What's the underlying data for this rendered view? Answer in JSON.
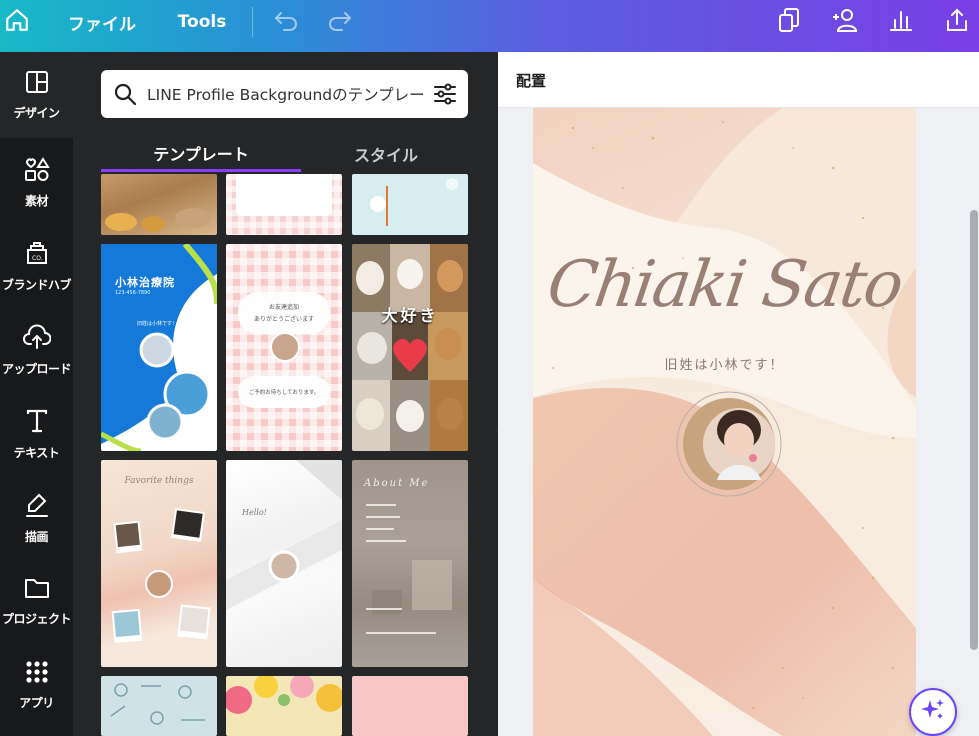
{
  "topbar": {
    "file_label": "ファイル",
    "tools_label": "Tools"
  },
  "rail": {
    "items": [
      {
        "label": "デザイン",
        "icon": "layout-icon"
      },
      {
        "label": "素材",
        "icon": "shapes-icon"
      },
      {
        "label": "ブランドハブ",
        "icon": "brand-icon"
      },
      {
        "label": "アップロード",
        "icon": "cloud-upload-icon"
      },
      {
        "label": "テキスト",
        "icon": "text-icon"
      },
      {
        "label": "描画",
        "icon": "draw-icon"
      },
      {
        "label": "プロジェクト",
        "icon": "folder-icon"
      },
      {
        "label": "アプリ",
        "icon": "apps-grid-icon"
      }
    ]
  },
  "panel": {
    "search_value": "LINE Profile Backgroundのテンプレート",
    "tabs": [
      "テンプレート",
      "スタイル"
    ],
    "templates": {
      "clinic_title": "小林治療院",
      "clinic_phone": "123-456-7890",
      "clinic_text": "旧姓は小林です！",
      "check_text1": "お友達追加",
      "check_text2": "ありがとうございます",
      "check_text3": "ご予約お待ちしております。",
      "dogs_text": "大好き",
      "favorite_text": "Favorite things",
      "hello_text": "Hello!",
      "about_text": "About Me"
    }
  },
  "editor": {
    "arrange_label": "配置",
    "name": "Chiaki Sato",
    "subtitle": "旧姓は小林です！"
  },
  "colors": {
    "accent": "#8b3dff",
    "panel_bg": "#252627",
    "rail_bg": "#18191b"
  }
}
